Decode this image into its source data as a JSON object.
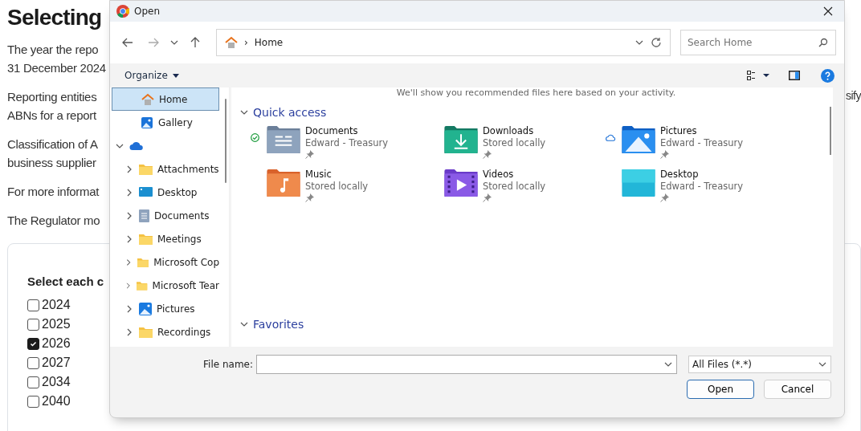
{
  "page": {
    "heading": "Selecting",
    "paragraphs": [
      {
        "lines": [
          "The year the repo",
          "31 December 2024"
        ]
      },
      {
        "lines": [
          "Reporting entities",
          "ABNs for a report"
        ],
        "tail": "sify"
      },
      {
        "lines": [
          "Classification of A",
          "business supplier"
        ]
      },
      {
        "lines": [
          "For more informat"
        ]
      },
      {
        "lines": [
          "The Regulator mo"
        ]
      }
    ],
    "card": {
      "title": "Select each c",
      "options": [
        {
          "label": "2024",
          "checked": false
        },
        {
          "label": "2025",
          "checked": false
        },
        {
          "label": "2026",
          "checked": true
        },
        {
          "label": "2027",
          "checked": false
        },
        {
          "label": "2034",
          "checked": false
        },
        {
          "label": "2040",
          "checked": false
        }
      ]
    }
  },
  "dialog": {
    "title": "Open",
    "address": {
      "crumb": "›",
      "location": "Home"
    },
    "search": {
      "placeholder": "Search Home"
    },
    "organize": "Organize",
    "sidebar": [
      {
        "label": "Home",
        "kind": "home",
        "selected": true
      },
      {
        "label": "Gallery",
        "kind": "gallery",
        "selected": false
      },
      {
        "kind": "cloud",
        "selected": false,
        "expanded": true,
        "children": [
          {
            "label": "Attachments",
            "kind": "folder",
            "selected": false,
            "expanded": false
          },
          {
            "label": "Desktop",
            "kind": "desktop",
            "selected": false,
            "expanded": false
          },
          {
            "label": "Documents",
            "kind": "documents",
            "selected": false,
            "expanded": false
          },
          {
            "label": "Meetings",
            "kind": "folder",
            "selected": false,
            "expanded": false
          },
          {
            "label": "Microsoft Cop",
            "kind": "folder",
            "selected": false,
            "expanded": false
          },
          {
            "label": "Microsoft Tear",
            "kind": "folder",
            "selected": false,
            "expanded": false
          },
          {
            "label": "Pictures",
            "kind": "pictures",
            "selected": false,
            "expanded": false
          },
          {
            "label": "Recordings",
            "kind": "folder",
            "selected": false,
            "expanded": false
          }
        ]
      }
    ],
    "hint": "We'll show you recommended files here based on your activity.",
    "sections": [
      {
        "title": "Quick access",
        "expanded": true,
        "items": [
          {
            "name": "Documents",
            "location": "Edward - Treasury",
            "kind": "documents",
            "synced": true,
            "cloud_only": false,
            "pinned": true
          },
          {
            "name": "Downloads",
            "location": "Stored locally",
            "kind": "downloads",
            "synced": false,
            "cloud_only": false,
            "pinned": true
          },
          {
            "name": "Pictures",
            "location": "Edward - Treasury",
            "kind": "pictures",
            "synced": false,
            "cloud_only": true,
            "pinned": true
          },
          {
            "name": "Music",
            "location": "Stored locally",
            "kind": "music",
            "synced": false,
            "cloud_only": false,
            "pinned": true
          },
          {
            "name": "Videos",
            "location": "Stored locally",
            "kind": "videos",
            "synced": false,
            "cloud_only": false,
            "pinned": true
          },
          {
            "name": "Desktop",
            "location": "Edward - Treasury",
            "kind": "desktop",
            "synced": false,
            "cloud_only": false,
            "pinned": true
          }
        ]
      },
      {
        "title": "Favorites",
        "expanded": true
      }
    ],
    "footer": {
      "file_name_label": "File name:",
      "filter": "All Files (*.*)",
      "buttons": [
        {
          "label": "Open",
          "kind": "default"
        },
        {
          "label": "Cancel",
          "kind": "normal"
        }
      ]
    }
  }
}
